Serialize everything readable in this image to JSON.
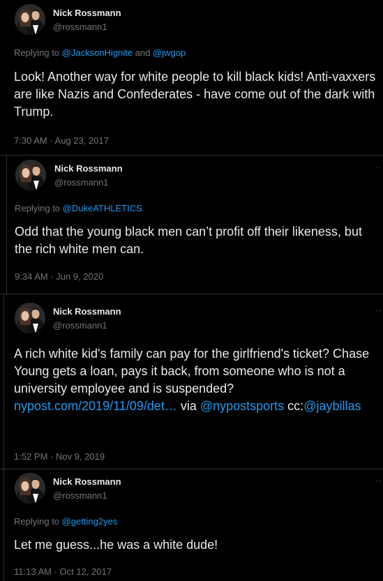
{
  "tweets": [
    {
      "name": "Nick Rossmann",
      "handle": "@rossmann1",
      "replying_prefix": "Replying to ",
      "replying_1": "@JacksonHignite",
      "replying_and": " and ",
      "replying_2": "@jwgop",
      "text": "Look! Another way for white people to kill black kids! Anti-vaxxers are like Nazis and Confederates - have come out of the dark with Trump.",
      "timestamp": "7:30 AM · Aug 23, 2017"
    },
    {
      "name": "Nick Rossmann",
      "handle": "@rossmann1",
      "replying_prefix": "Replying to ",
      "replying_1": "@DukeATHLETICS",
      "text": "Odd that the young black men can’t profit off their likeness, but the rich white men can.",
      "timestamp": "9:34 AM · Jun 9, 2020"
    },
    {
      "name": "Nick Rossmann",
      "handle": "@rossmann1",
      "text_1": "A rich white kid's family can pay for the girlfriend's ticket? Chase Young gets a loan, pays it back, from someone who is not a university employee and is suspended?  ",
      "link_1": "nypost.com/2019/11/09/det…",
      "text_2": " via ",
      "link_2": "@nypostsports",
      "text_3": " cc:",
      "link_3": "@jaybillas",
      "timestamp": "1:52 PM · Nov 9, 2019"
    },
    {
      "name": "Nick Rossmann",
      "handle": "@rossmann1",
      "replying_prefix": "Replying to ",
      "replying_1": "@getting2yes",
      "text": "Let me guess...he was a white dude!",
      "timestamp": "11:13 AM · Oct 12, 2017"
    }
  ],
  "more_icon": "more-options-icon",
  "colors": {
    "background": "#000000",
    "text": "#e7e9ea",
    "muted": "#71767b",
    "link": "#1d9bf0",
    "border": "#2f3336"
  }
}
